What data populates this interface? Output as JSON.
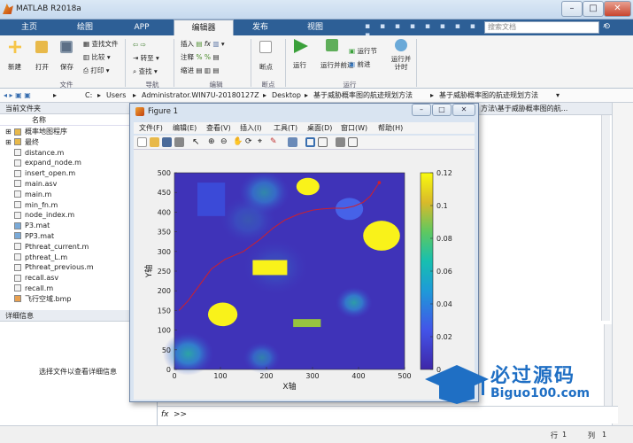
{
  "window": {
    "title": "MATLAB R2018a"
  },
  "tabs": [
    "主页",
    "绘图",
    "APP",
    "编辑器",
    "发布",
    "视图"
  ],
  "search": {
    "placeholder": "搜索文档"
  },
  "ribbon": {
    "file": {
      "new": "新建",
      "open": "打开",
      "save": "保存",
      "find_files": "查找文件",
      "compare": "比较",
      "print": "打印",
      "group": "文件"
    },
    "nav": {
      "goto": "转至",
      "find": "查找",
      "group": "导航"
    },
    "edit": {
      "insert": "插入",
      "comment": "注释",
      "indent": "缩进",
      "group": "编辑"
    },
    "breakpoints": {
      "label": "断点",
      "group": "断点"
    },
    "run": {
      "run": "运行",
      "run_advance": "运行并前进",
      "run_section": "运行节",
      "advance": "前进",
      "run_time": "运行并计时",
      "group": "运行"
    }
  },
  "address": {
    "parts": [
      "C:",
      "Users",
      "Administrator.WIN7U-20180127Z",
      "Desktop",
      "基于威胁概率图的航迹规划方法",
      "基于威胁概率图的航迹规划方法"
    ],
    "right_path": "方法\\基于威胁概率图的航..."
  },
  "left_pane": {
    "title": "当前文件夹",
    "column": "名称",
    "files": [
      {
        "name": "概率地图程序",
        "type": "folder"
      },
      {
        "name": "最终",
        "type": "folder"
      },
      {
        "name": "distance.m",
        "type": "m"
      },
      {
        "name": "expand_node.m",
        "type": "m"
      },
      {
        "name": "insert_open.m",
        "type": "m"
      },
      {
        "name": "main.asv",
        "type": "asv"
      },
      {
        "name": "main.m",
        "type": "m"
      },
      {
        "name": "min_fn.m",
        "type": "m"
      },
      {
        "name": "node_index.m",
        "type": "m"
      },
      {
        "name": "P3.mat",
        "type": "mat"
      },
      {
        "name": "PP3.mat",
        "type": "mat"
      },
      {
        "name": "Pthreat_current.m",
        "type": "m"
      },
      {
        "name": "pthreat_L.m",
        "type": "m"
      },
      {
        "name": "Pthreat_previous.m",
        "type": "m"
      },
      {
        "name": "recall.asv",
        "type": "asv"
      },
      {
        "name": "recall.m",
        "type": "m"
      },
      {
        "name": "飞行空域.bmp",
        "type": "bmp"
      }
    ],
    "details_title": "详细信息",
    "details_text": "选择文件以查看详细信息"
  },
  "figure": {
    "title": "Figure 1",
    "menu": [
      "文件(F)",
      "编辑(E)",
      "查看(V)",
      "插入(I)",
      "工具(T)",
      "桌面(D)",
      "窗口(W)",
      "帮助(H)"
    ]
  },
  "chart_data": {
    "type": "heatmap",
    "xlabel": "X轴",
    "ylabel": "Y轴",
    "xlim": [
      0,
      500
    ],
    "ylim": [
      0,
      500
    ],
    "xticks": [
      0,
      100,
      200,
      300,
      400,
      500
    ],
    "yticks": [
      0,
      50,
      100,
      150,
      200,
      250,
      300,
      350,
      400,
      450,
      500
    ],
    "colorbar": {
      "min": 0,
      "max": 0.12,
      "ticks": [
        0,
        0.02,
        0.04,
        0.06,
        0.08,
        0.1,
        0.12
      ]
    },
    "obstacles": [
      {
        "shape": "rect",
        "x": [
          50,
          110
        ],
        "y": [
          390,
          475
        ],
        "color": "#3b4ad8"
      },
      {
        "shape": "ellipse",
        "cx": 290,
        "cy": 465,
        "rx": 25,
        "ry": 22,
        "color": "#f9f21a"
      },
      {
        "shape": "ellipse",
        "cx": 380,
        "cy": 408,
        "rx": 30,
        "ry": 28,
        "color": "#4662e8"
      },
      {
        "shape": "ellipse",
        "cx": 450,
        "cy": 340,
        "rx": 40,
        "ry": 38,
        "color": "#f9f21a"
      },
      {
        "shape": "rect",
        "x": [
          170,
          245
        ],
        "y": [
          240,
          278
        ],
        "color": "#f9f21a"
      },
      {
        "shape": "ellipse",
        "cx": 105,
        "cy": 140,
        "rx": 32,
        "ry": 30,
        "color": "#f9f21a"
      },
      {
        "shape": "rect",
        "x": [
          258,
          318
        ],
        "y": [
          108,
          128
        ],
        "color": "#97c43f"
      }
    ],
    "threats": [
      {
        "cx": 195,
        "cy": 450,
        "r": 55,
        "intensity": 0.6
      },
      {
        "cx": 390,
        "cy": 170,
        "r": 40,
        "intensity": 0.75
      },
      {
        "cx": 30,
        "cy": 40,
        "r": 55,
        "intensity": 0.8
      },
      {
        "cx": 190,
        "cy": 30,
        "r": 40,
        "intensity": 0.55
      },
      {
        "cx": 160,
        "cy": 380,
        "r": 60,
        "intensity": 0.25
      },
      {
        "cx": 220,
        "cy": 260,
        "r": 70,
        "intensity": 0.2
      }
    ],
    "path": {
      "color": "#d0202a",
      "x": [
        10,
        30,
        55,
        80,
        110,
        150,
        185,
        215,
        240,
        270,
        300,
        320,
        345,
        370,
        390,
        410,
        425,
        445
      ],
      "y": [
        150,
        175,
        215,
        255,
        280,
        300,
        330,
        360,
        380,
        395,
        405,
        408,
        410,
        410,
        415,
        425,
        440,
        475
      ]
    }
  },
  "command": {
    "fx": "fx",
    "prompt": ">>"
  },
  "status": {
    "row_label": "行",
    "row": "1",
    "col_label": "列",
    "col": "1"
  },
  "watermark": {
    "main": "必过源码",
    "sub": "Biguo100.com"
  },
  "colors": {
    "accent": "#2d5f96",
    "parula_low": "#3e26a8",
    "parula_high": "#f9fb0e"
  }
}
